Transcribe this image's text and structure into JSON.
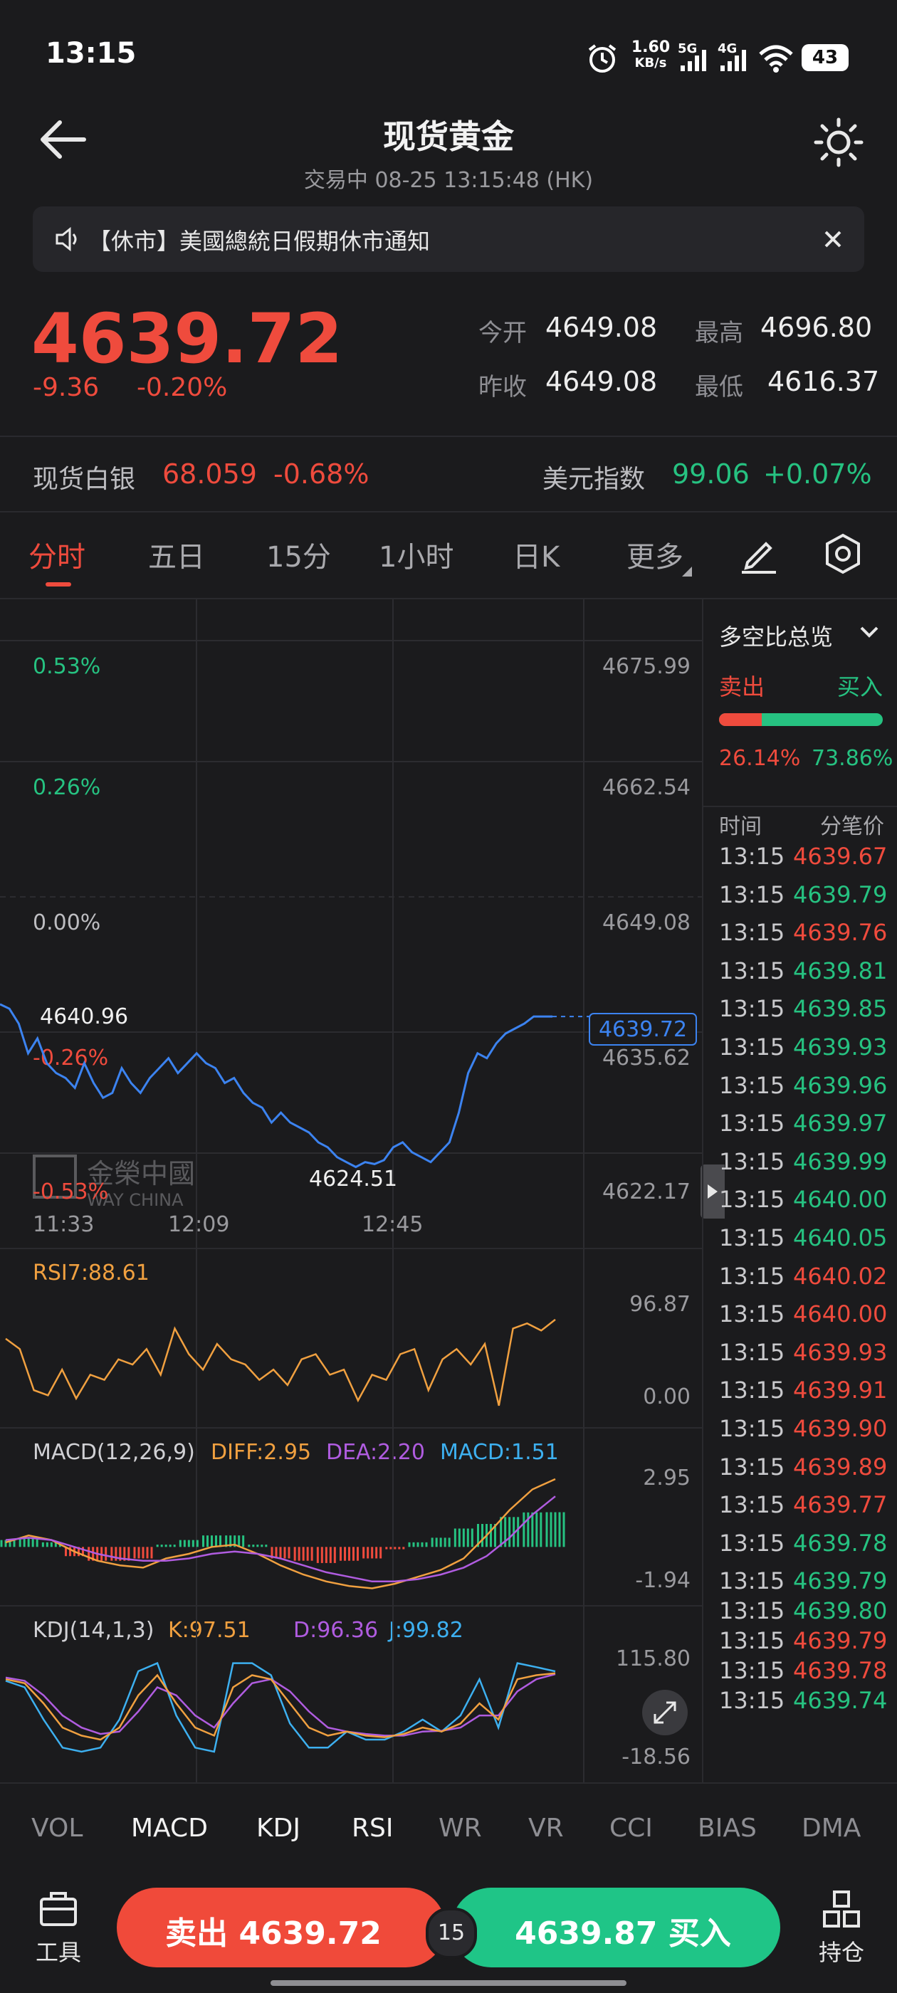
{
  "status_bar": {
    "time": "13:15",
    "net_speed_value": "1.60",
    "net_speed_unit": "KB/s",
    "sig1": "5G",
    "sig2": "4G",
    "battery": "43"
  },
  "header": {
    "title": "现货黄金",
    "subtitle": "交易中 08-25 13:15:48 (HK)"
  },
  "notice": {
    "text": "【休市】美國總統日假期休市通知"
  },
  "quote": {
    "price": "4639.72",
    "change": "-9.36",
    "change_pct": "-0.20%",
    "open_label": "今开",
    "open": "4649.08",
    "high_label": "最高",
    "high": "4696.80",
    "prev_close_label": "昨收",
    "prev_close": "4649.08",
    "low_label": "最低",
    "low": "4616.37"
  },
  "related": {
    "silver_label": "现货白银",
    "silver_price": "68.059",
    "silver_pct": "-0.68%",
    "dxy_label": "美元指数",
    "dxy_price": "99.06",
    "dxy_pct": "+0.07%"
  },
  "period_tabs": [
    "分时",
    "五日",
    "15分",
    "1小时",
    "日K",
    "更多"
  ],
  "active_tab": "分时",
  "colors": {
    "up": "#ef4b3d",
    "down": "#26c281",
    "line": "#3c83f0",
    "orange": "#f0a040",
    "purple": "#b05ce0",
    "blue": "#3db0f0"
  },
  "main_chart": {
    "pct_labels": [
      "0.53%",
      "0.26%",
      "0.00%",
      "-0.26%",
      "-0.53%"
    ],
    "price_labels": [
      "4675.99",
      "4662.54",
      "4649.08",
      "4635.62",
      "4622.17"
    ],
    "time_labels": [
      "11:33",
      "12:09",
      "12:45"
    ],
    "high_mark": "4640.96",
    "low_mark": "4624.51",
    "current_tag": "4639.72",
    "watermark": "金榮中國",
    "watermark_en": "WAY CHINA"
  },
  "chart_data": [
    {
      "type": "line",
      "title": "分时",
      "ylim": [
        4622.17,
        4675.99
      ],
      "x": [
        "11:33",
        "12:09",
        "12:45"
      ],
      "series": [
        {
          "values": [
            4640.96,
            4640.5,
            4639.0,
            4636.0,
            4637.5,
            4635.0,
            4634.0,
            4633.5,
            4632.5,
            4635.0,
            4633.0,
            4631.5,
            4632.0,
            4634.5,
            4633.0,
            4632.0,
            4633.5,
            4634.5,
            4635.5,
            4634.0,
            4635.0,
            4636.0,
            4635.0,
            4634.5,
            4633.0,
            4633.5,
            4632.0,
            4631.0,
            4630.5,
            4629.0,
            4630.0,
            4629.0,
            4628.5,
            4628.0,
            4627.0,
            4626.5,
            4625.5,
            4625.0,
            4624.51,
            4625.0,
            4624.8,
            4625.2,
            4626.5,
            4627.0,
            4626.0,
            4625.5,
            4625.0,
            4626.0,
            4627.0,
            4630.0,
            4634.0,
            4636.0,
            4635.5,
            4637.0,
            4638.0,
            4638.5,
            4639.0,
            4639.72,
            4639.72,
            4639.72
          ]
        }
      ]
    },
    {
      "type": "line",
      "title": "RSI7:88.61",
      "ylim": [
        0.0,
        96.87
      ],
      "series": [
        {
          "name": "RSI7",
          "values": [
            70,
            60,
            20,
            15,
            40,
            12,
            35,
            30,
            50,
            45,
            60,
            35,
            80,
            55,
            40,
            65,
            50,
            45,
            30,
            40,
            25,
            50,
            55,
            35,
            40,
            10,
            35,
            30,
            55,
            60,
            20,
            50,
            60,
            45,
            65,
            5,
            80,
            85,
            78,
            88.61
          ]
        }
      ]
    },
    {
      "type": "bar",
      "title": "MACD(12,26,9)",
      "ylim": [
        -1.94,
        2.95
      ],
      "series": [
        {
          "name": "DIFF",
          "values": [
            0.2,
            0.5,
            0.3,
            -0.2,
            -0.6,
            -0.8,
            -0.9,
            -0.5,
            -0.3,
            0.0,
            0.1,
            -0.3,
            -0.8,
            -1.2,
            -1.5,
            -1.7,
            -1.8,
            -1.6,
            -1.3,
            -1.0,
            -0.5,
            0.5,
            1.6,
            2.5,
            2.95
          ]
        },
        {
          "name": "DEA",
          "values": [
            0.3,
            0.4,
            0.3,
            0.0,
            -0.3,
            -0.5,
            -0.6,
            -0.6,
            -0.5,
            -0.3,
            -0.2,
            -0.3,
            -0.5,
            -0.8,
            -1.1,
            -1.3,
            -1.5,
            -1.5,
            -1.4,
            -1.2,
            -0.9,
            -0.4,
            0.4,
            1.4,
            2.2
          ]
        },
        {
          "name": "MACD",
          "values": [
            0.3,
            0.4,
            0.2,
            -0.4,
            -0.6,
            -0.6,
            -0.5,
            0.1,
            0.3,
            0.5,
            0.5,
            0.1,
            -0.5,
            -0.6,
            -0.7,
            -0.6,
            -0.5,
            -0.1,
            0.2,
            0.4,
            0.8,
            1.0,
            1.3,
            1.5,
            1.51
          ]
        }
      ],
      "legend": [
        "DIFF:2.95",
        "DEA:2.20",
        "MACD:1.51"
      ]
    },
    {
      "type": "line",
      "title": "KDJ(14,1,3)",
      "ylim": [
        -18.56,
        115.8
      ],
      "series": [
        {
          "name": "K",
          "values": [
            90,
            85,
            60,
            30,
            20,
            15,
            30,
            70,
            95,
            60,
            30,
            20,
            80,
            95,
            90,
            60,
            30,
            20,
            25,
            20,
            18,
            22,
            30,
            25,
            35,
            60,
            40,
            90,
            95,
            97.51
          ]
        },
        {
          "name": "D",
          "values": [
            92,
            88,
            70,
            45,
            30,
            22,
            25,
            50,
            80,
            70,
            45,
            30,
            60,
            85,
            90,
            75,
            50,
            30,
            25,
            22,
            20,
            20,
            25,
            26,
            30,
            45,
            45,
            75,
            90,
            96.36
          ]
        },
        {
          "name": "J",
          "values": [
            88,
            80,
            40,
            5,
            0,
            5,
            40,
            100,
            110,
            45,
            5,
            0,
            110,
            110,
            95,
            35,
            5,
            5,
            25,
            15,
            15,
            25,
            40,
            25,
            45,
            90,
            30,
            110,
            105,
            99.82
          ]
        }
      ],
      "legend": [
        "K:97.51",
        "D:96.36",
        "J:99.82"
      ]
    }
  ],
  "rsi": {
    "label": "RSI7:88.61",
    "max": "96.87",
    "min": "0.00"
  },
  "macd": {
    "label": "MACD(12,26,9)",
    "diff": "DIFF:2.95",
    "dea": "DEA:2.20",
    "macd": "MACD:1.51",
    "max": "2.95",
    "min": "-1.94"
  },
  "kdj": {
    "label": "KDJ(14,1,3)",
    "k": "K:97.51",
    "d": "D:96.36",
    "j": "J:99.82",
    "max": "115.80",
    "min": "-18.56"
  },
  "side_panel": {
    "title": "多空比总览",
    "sell_label": "卖出",
    "buy_label": "买入",
    "sell_ratio": 26.14,
    "buy_ratio": 73.86,
    "sell_pct": "26.14%",
    "buy_pct": "73.86%",
    "col_time": "时间",
    "col_price": "分笔价",
    "ticks": [
      {
        "time": "13:15",
        "price": "4639.67",
        "dir": "up"
      },
      {
        "time": "13:15",
        "price": "4639.79",
        "dir": "down"
      },
      {
        "time": "13:15",
        "price": "4639.76",
        "dir": "up"
      },
      {
        "time": "13:15",
        "price": "4639.81",
        "dir": "down"
      },
      {
        "time": "13:15",
        "price": "4639.85",
        "dir": "down"
      },
      {
        "time": "13:15",
        "price": "4639.93",
        "dir": "down"
      },
      {
        "time": "13:15",
        "price": "4639.96",
        "dir": "down"
      },
      {
        "time": "13:15",
        "price": "4639.97",
        "dir": "down"
      },
      {
        "time": "13:15",
        "price": "4639.99",
        "dir": "down"
      },
      {
        "time": "13:15",
        "price": "4640.00",
        "dir": "down"
      },
      {
        "time": "13:15",
        "price": "4640.05",
        "dir": "down"
      },
      {
        "time": "13:15",
        "price": "4640.02",
        "dir": "up"
      },
      {
        "time": "13:15",
        "price": "4640.00",
        "dir": "up"
      },
      {
        "time": "13:15",
        "price": "4639.93",
        "dir": "up"
      },
      {
        "time": "13:15",
        "price": "4639.91",
        "dir": "up"
      },
      {
        "time": "13:15",
        "price": "4639.90",
        "dir": "up"
      },
      {
        "time": "13:15",
        "price": "4639.89",
        "dir": "up"
      },
      {
        "time": "13:15",
        "price": "4639.77",
        "dir": "up"
      },
      {
        "time": "13:15",
        "price": "4639.78",
        "dir": "down"
      },
      {
        "time": "13:15",
        "price": "4639.79",
        "dir": "down"
      },
      {
        "time": "13:15",
        "price": "4639.80",
        "dir": "down"
      },
      {
        "time": "13:15",
        "price": "4639.79",
        "dir": "up"
      },
      {
        "time": "13:15",
        "price": "4639.78",
        "dir": "up"
      },
      {
        "time": "13:15",
        "price": "4639.74",
        "dir": "down"
      }
    ]
  },
  "indicator_tabs": [
    "VOL",
    "MACD",
    "KDJ",
    "RSI",
    "WR",
    "VR",
    "CCI",
    "BIAS",
    "DMA"
  ],
  "active_indicators": [
    "MACD",
    "KDJ",
    "RSI"
  ],
  "bottom_bar": {
    "tools_label": "工具",
    "sell_label": "卖出 4639.72",
    "spread": "15",
    "buy_label": "4639.87 买入",
    "positions_label": "持仓"
  }
}
